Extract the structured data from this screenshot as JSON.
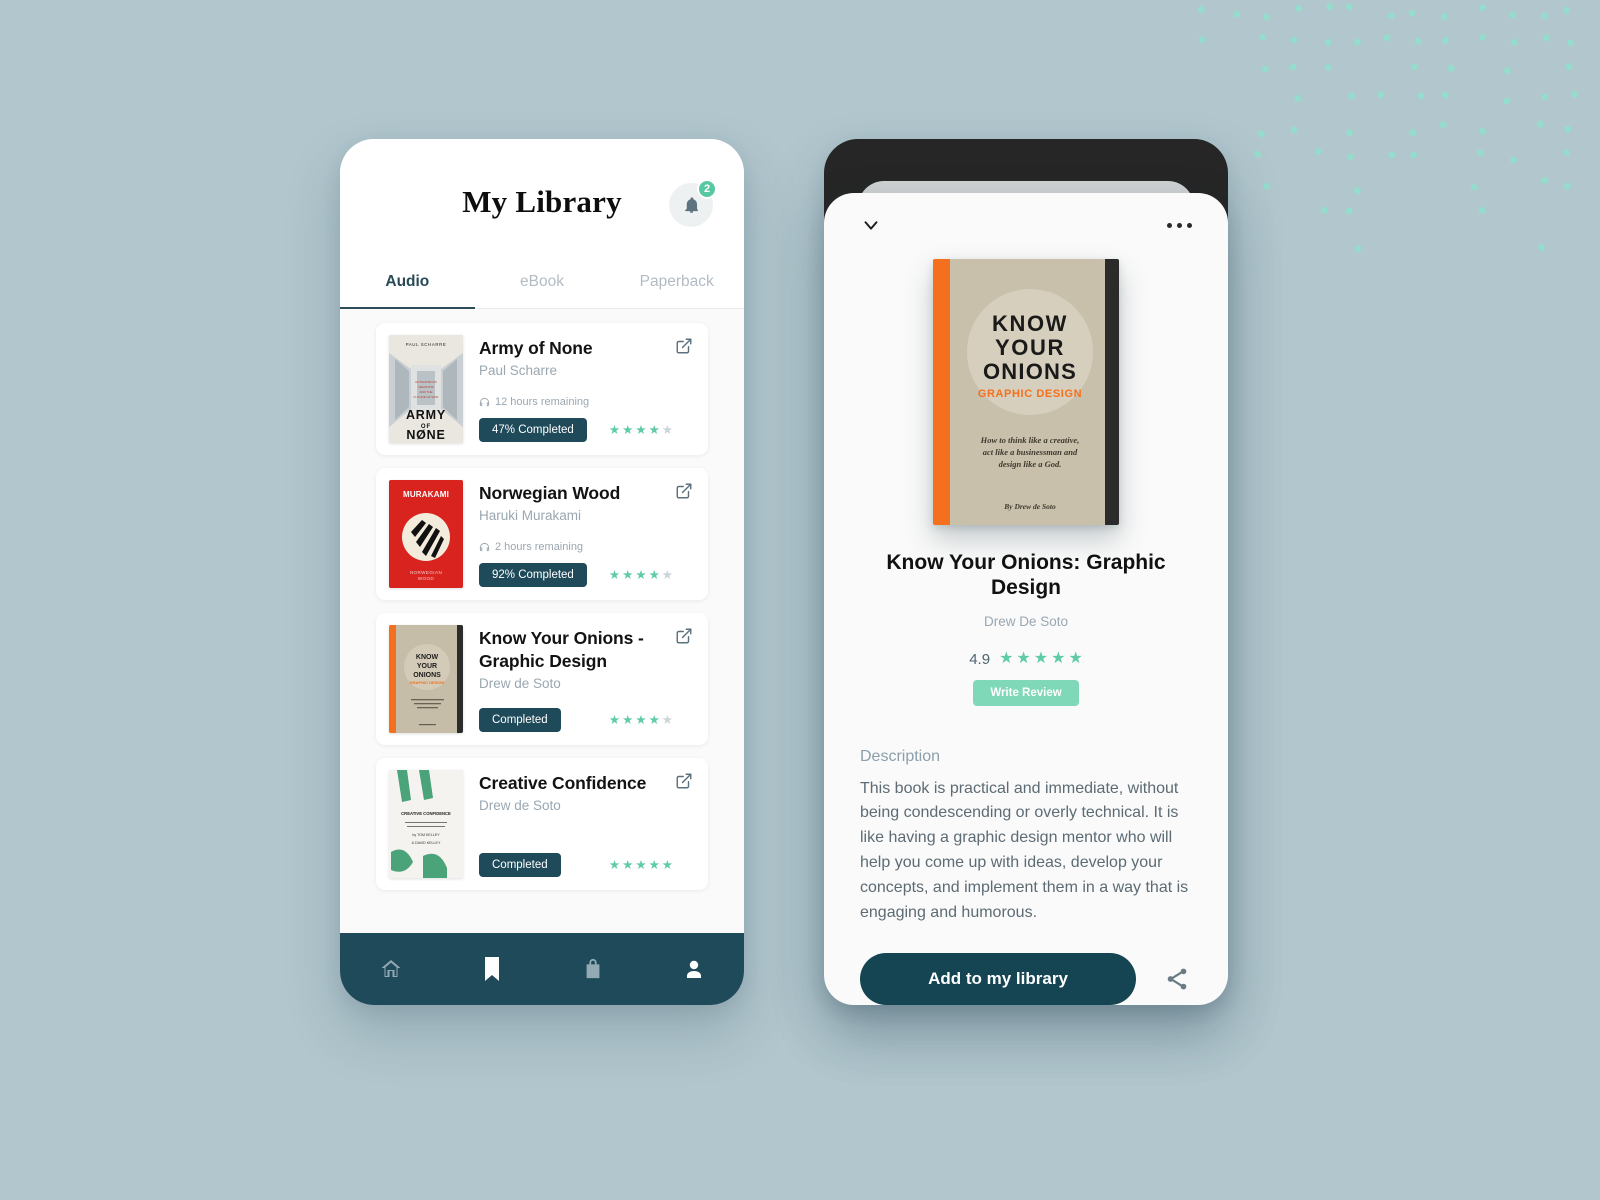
{
  "background": {
    "color": "#b1c6cd",
    "dot_color": "#8fe0cd"
  },
  "theme": {
    "dark_teal": "#1f4a5a",
    "deep_teal": "#154552",
    "mint": "#5fcba7",
    "mint_light": "#7fd8b8",
    "muted": "#9aa7b1"
  },
  "library": {
    "title": "My Library",
    "notification": {
      "icon": "bell-icon",
      "count": "2"
    },
    "tabs": [
      {
        "label": "Audio",
        "active": true
      },
      {
        "label": "eBook",
        "active": false
      },
      {
        "label": "Paperback",
        "active": false
      }
    ],
    "books": [
      {
        "title": "Army of None",
        "author": "Paul Scharre",
        "remaining": "12 hours remaining",
        "remaining_icon": "headphones-icon",
        "status": "47% Completed",
        "rating": 4,
        "max_rating": 5,
        "link_icon": "external-link-icon",
        "cover": {
          "style": "army-of-none",
          "top_text": "PAUL SCHARRE",
          "mid_text": "AUTONOMOUS WEAPONS AND THE FUTURE OF WAR",
          "line1": "ARMY",
          "line2": "OF",
          "line3": "NONE"
        }
      },
      {
        "title": "Norwegian Wood",
        "author": "Haruki Murakami",
        "remaining": "2 hours remaining",
        "remaining_icon": "headphones-icon",
        "status": "92% Completed",
        "rating": 4,
        "max_rating": 5,
        "link_icon": "external-link-icon",
        "cover": {
          "style": "norwegian-wood",
          "top_text": "MURAKAMI",
          "line1": "NORWEGIAN",
          "line2": "WOOD"
        }
      },
      {
        "title": "Know Your Onions - Graphic Design",
        "author": "Drew de Soto",
        "remaining": "",
        "remaining_icon": "",
        "status": "Completed",
        "rating": 4,
        "max_rating": 5,
        "link_icon": "external-link-icon",
        "cover": {
          "style": "know-your-onions",
          "line1": "KNOW",
          "line2": "YOUR",
          "line3": "ONIONS",
          "subtitle": "GRAPHIC DESIGN"
        }
      },
      {
        "title": "Creative Confidence",
        "author": "Drew de Soto",
        "remaining": "",
        "remaining_icon": "",
        "status": "Completed",
        "rating": 5,
        "max_rating": 5,
        "link_icon": "external-link-icon",
        "cover": {
          "style": "creative-confidence",
          "title_text": "CREATIVE CONFIDENCE"
        }
      }
    ],
    "bottom_nav": [
      {
        "icon": "home-icon",
        "active": false
      },
      {
        "icon": "bookmark-icon",
        "active": true
      },
      {
        "icon": "shopping-bag-icon",
        "active": false
      },
      {
        "icon": "profile-icon",
        "active": true
      }
    ]
  },
  "detail": {
    "back_icon": "chevron-down-icon",
    "menu_icon": "more-horizontal-icon",
    "cover": {
      "line1": "KNOW",
      "line2": "YOUR",
      "line3": "ONIONS",
      "subtitle": "GRAPHIC DESIGN",
      "blurb": "How to think like a creative, act like a businessman and design like a God.",
      "byline": "By Drew de Soto"
    },
    "title": "Know Your Onions: Graphic Design",
    "author": "Drew De Soto",
    "rating_value": "4.9",
    "rating_stars": 5,
    "write_review_label": "Write Review",
    "description_label": "Description",
    "description_text": "This book is practical and immediate, without being condescending or overly technical. It is like having a graphic design mentor who will help you come up with ideas, develop your concepts, and implement them in a way that is engaging and humorous.",
    "add_button_label": "Add to my library",
    "share_icon": "share-icon"
  }
}
